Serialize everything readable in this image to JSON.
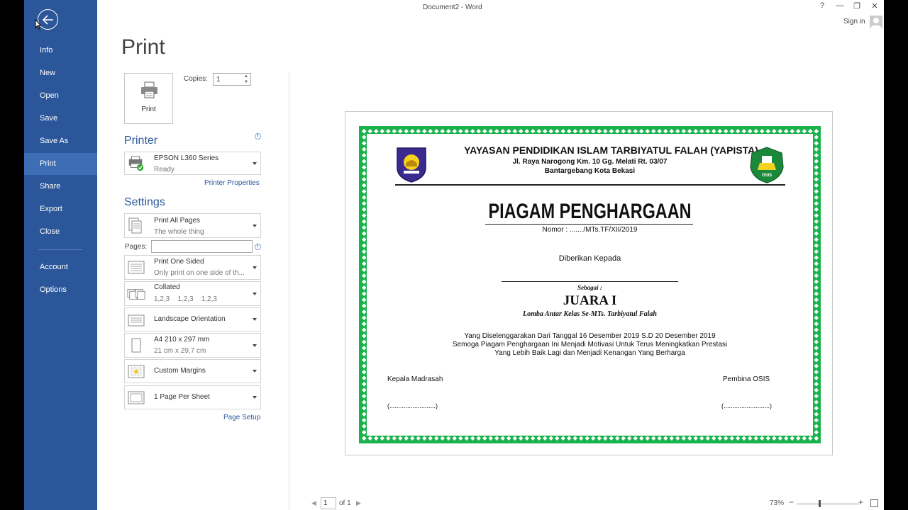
{
  "window": {
    "title": "Document2 - Word",
    "help": "?",
    "minimize": "—",
    "restore": "❐",
    "close": "✕",
    "signin": "Sign in"
  },
  "sidebar": {
    "items": [
      {
        "label": "Info"
      },
      {
        "label": "New"
      },
      {
        "label": "Open"
      },
      {
        "label": "Save"
      },
      {
        "label": "Save As"
      },
      {
        "label": "Print"
      },
      {
        "label": "Share"
      },
      {
        "label": "Export"
      },
      {
        "label": "Close"
      },
      {
        "label": "Account"
      },
      {
        "label": "Options"
      }
    ],
    "active": "Print"
  },
  "print": {
    "title": "Print",
    "button_label": "Print",
    "copies_label": "Copies:",
    "copies_value": "1"
  },
  "printer": {
    "heading": "Printer",
    "name": "EPSON L360 Series",
    "status": "Ready",
    "properties_link": "Printer Properties"
  },
  "settings": {
    "heading": "Settings",
    "pages_label": "Pages:",
    "pages_value": "",
    "options": [
      {
        "line1": "Print All Pages",
        "line2": "The whole thing"
      },
      {
        "line1": "Print One Sided",
        "line2": "Only print on one side of th..."
      },
      {
        "line1": "Collated",
        "line2": "1,2,3    1,2,3    1,2,3"
      },
      {
        "line1": "Landscape Orientation",
        "line2": ""
      },
      {
        "line1": "A4 210 x 297 mm",
        "line2": "21 cm x 29,7 cm"
      },
      {
        "line1": "Custom Margins",
        "line2": ""
      },
      {
        "line1": "1 Page Per Sheet",
        "line2": ""
      }
    ],
    "page_setup_link": "Page Setup"
  },
  "certificate": {
    "org_name": "YAYASAN PENDIDIKAN ISLAM TARBIYATUL FALAH (YAPISTA)",
    "address1": "Jl. Raya Narogong Km. 10 Gg. Melati Rt. 03/07",
    "address2": "Bantargebang Kota Bekasi",
    "title": "PIAGAM PENGHARGAAN",
    "number": "Nomor : ......./MTs.TF/XII/2019",
    "given_to": "Diberikan Kepada",
    "as_label": "Sebagai :",
    "rank": "JUARA I",
    "competition": "Lomba Antar Kelas Se-MTs. Tarbiyatul Falah",
    "body1": "Yang Diselenggarakan Dari Tanggal 16 Desember 2019 S.D 20 Desember 2019",
    "body2": "Semoga Piagam Penghargaan Ini Menjadi Motivasi Untuk Terus Meningkatkan Prestasi",
    "body3": "Yang Lebih Baik Lagi dan Menjadi Kenangan Yang Berharga",
    "sign_left_title": "Kepala Madrasah",
    "sign_right_title": "Pembina OSIS",
    "sign_left_name": "(..........................)",
    "sign_right_name": "(..........................)",
    "logo_right_text": "OSIS",
    "border_color": "#19b24c"
  },
  "footer": {
    "page_num": "1",
    "page_of": "of 1",
    "zoom": "73%"
  }
}
